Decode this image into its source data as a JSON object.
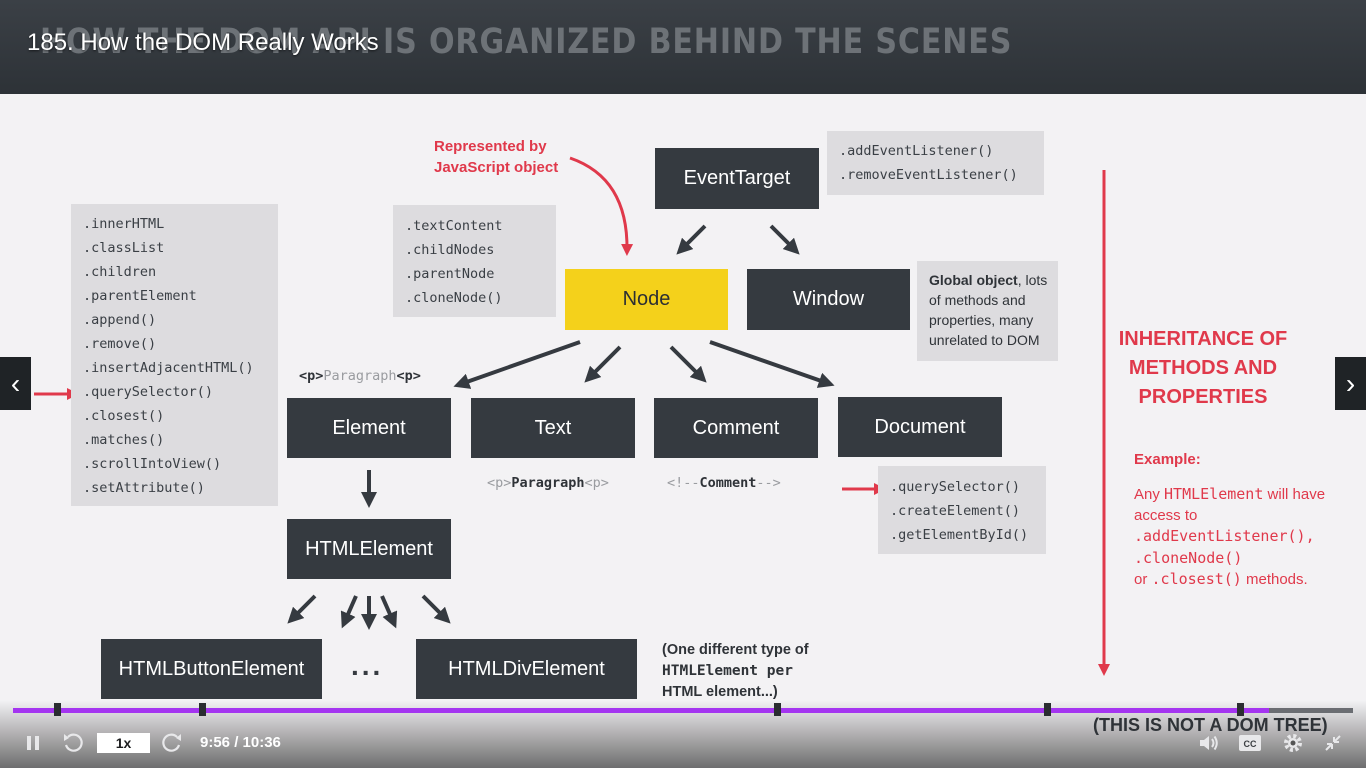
{
  "video": {
    "title": "185. How the DOM Really Works",
    "elapsed": "9:56",
    "duration": "10:36",
    "time_display": "9:56 / 10:36",
    "speed": "1x",
    "progress_percent": 93.7,
    "accent_color": "#a435f0"
  },
  "slide": {
    "title": "HOW THE DOM API IS ORGANIZED BEHIND THE SCENES",
    "represented_by": [
      "Represented by",
      "JavaScript object"
    ],
    "boxes": {
      "event_target": "EventTarget",
      "node": "Node",
      "window": "Window",
      "element": "Element",
      "text": "Text",
      "comment": "Comment",
      "document": "Document",
      "html_element": "HTMLElement",
      "html_button_element": "HTMLButtonElement",
      "html_div_element": "HTMLDivElement"
    },
    "event_target_methods": [
      ".addEventListener()",
      ".removeEventListener()"
    ],
    "node_methods": [
      ".textContent",
      ".childNodes",
      ".parentNode",
      ".cloneNode()"
    ],
    "element_methods": [
      ".innerHTML",
      ".classList",
      ".children",
      ".parentElement",
      ".append()",
      ".remove()",
      ".insertAdjacentHTML()",
      ".querySelector()",
      ".closest()",
      ".matches()",
      ".scrollIntoView()",
      ".setAttribute()"
    ],
    "document_methods": [
      ".querySelector()",
      ".createElement()",
      ".getElementById()"
    ],
    "window_note": {
      "bold": "Global object",
      "rest": ", lots of methods and properties, many unrelated to DOM"
    },
    "element_example": {
      "open": "<p>",
      "word": "Paragraph",
      "close": "<p>"
    },
    "text_example": {
      "open": "<p>",
      "word": "Paragraph",
      "close": "<p>"
    },
    "comment_example": {
      "open": "<!--",
      "word": "Comment",
      "close": "-->"
    },
    "ellipsis": "...",
    "html_element_note": [
      "(One different type of",
      "HTMLElement per",
      "HTML element...)"
    ],
    "inheritance_label": [
      "INHERITANCE OF",
      "METHODS AND",
      "PROPERTIES"
    ],
    "example_heading": "Example:",
    "example_text": {
      "p1": "Any ",
      "code1": "HTMLElement",
      "p2": " will have access to",
      "code2": ".addEventListener(),",
      "code3": ".cloneNode()",
      "p3": "or ",
      "code4": ".closest()",
      "p4": " methods."
    },
    "footnote": "(THIS IS NOT A DOM TREE)",
    "colors": {
      "box": "#353a40",
      "node": "#f4d11b",
      "accent_red": "#e0394b",
      "panel": "#dddcdf"
    }
  },
  "icons": {
    "prev": "chevron-left-icon",
    "next": "chevron-right-icon",
    "pause": "pause-icon",
    "rewind": "rewind-5-icon",
    "forward": "forward-5-icon",
    "volume": "volume-icon",
    "captions": "captions-icon",
    "settings": "gear-icon",
    "exit_fullscreen": "exit-fullscreen-icon"
  }
}
